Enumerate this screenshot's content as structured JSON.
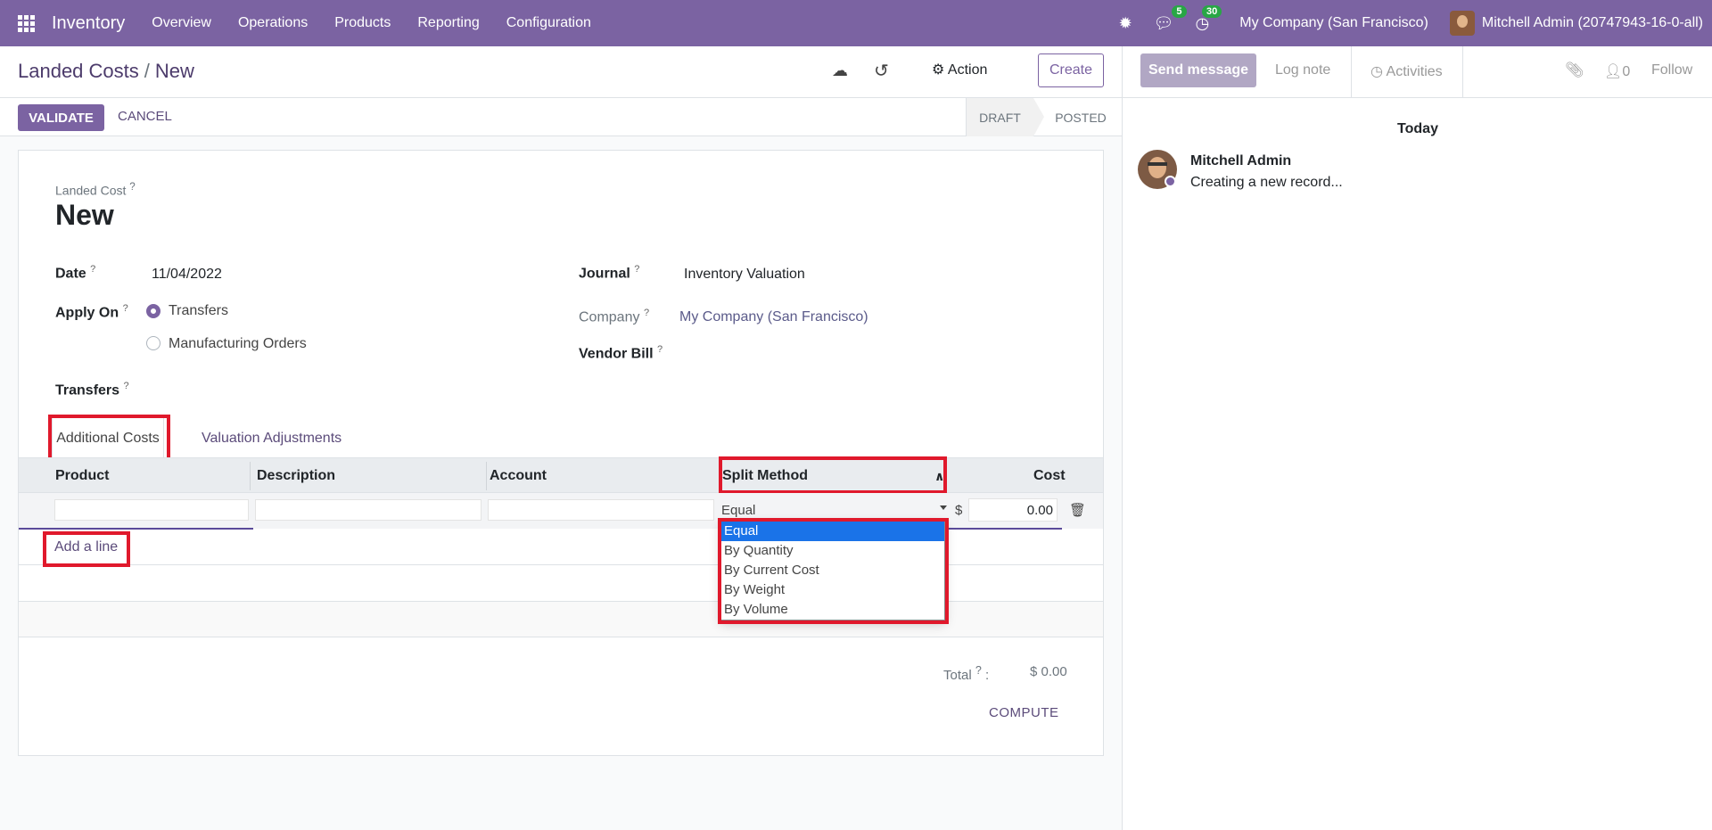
{
  "navbar": {
    "brand": "Inventory",
    "menu": [
      "Overview",
      "Operations",
      "Products",
      "Reporting",
      "Configuration"
    ],
    "messages_count": "5",
    "activities_count": "30",
    "company": "My Company (San Francisco)",
    "user": "Mitchell Admin (20747943-16-0-all)"
  },
  "control": {
    "breadcrumb_parent": "Landed Costs",
    "breadcrumb_sep": "/",
    "breadcrumb_current": "New",
    "action_label": "Action",
    "create_label": "Create"
  },
  "statusbar": {
    "validate_label": "VALIDATE",
    "cancel_label": "CANCEL",
    "stages": [
      "DRAFT",
      "POSTED"
    ]
  },
  "form": {
    "record_label": "Landed Cost",
    "record_title": "New",
    "date_label": "Date",
    "date_value": "11/04/2022",
    "apply_on_label": "Apply On",
    "apply_options": [
      "Transfers",
      "Manufacturing Orders"
    ],
    "transfers_label": "Transfers",
    "journal_label": "Journal",
    "journal_value": "Inventory Valuation",
    "company_label": "Company",
    "company_value": "My Company (San Francisco)",
    "vendor_bill_label": "Vendor Bill",
    "help_mark": "?"
  },
  "tabs": [
    "Additional Costs",
    "Valuation Adjustments"
  ],
  "table": {
    "headers": [
      "Product",
      "Description",
      "Account",
      "Split Method",
      "Cost"
    ],
    "split_value": "Equal",
    "currency": "$",
    "cost_value": "0.00",
    "add_line": "Add a line"
  },
  "dropdown": {
    "options": [
      "Equal",
      "By Quantity",
      "By Current Cost",
      "By Weight",
      "By Volume"
    ],
    "selected": "Equal"
  },
  "totals": {
    "total_label": "Total",
    "total_value": "$ 0.00",
    "compute_label": "COMPUTE"
  },
  "chatter": {
    "send_message": "Send message",
    "log_note": "Log note",
    "activities": "Activities",
    "followers": "0",
    "follow": "Follow",
    "today": "Today",
    "author": "Mitchell Admin",
    "message": "Creating a new record..."
  },
  "colors": {
    "brand": "#7b63a2",
    "highlight": "#e0192c",
    "selected_option": "#1a73e8"
  }
}
